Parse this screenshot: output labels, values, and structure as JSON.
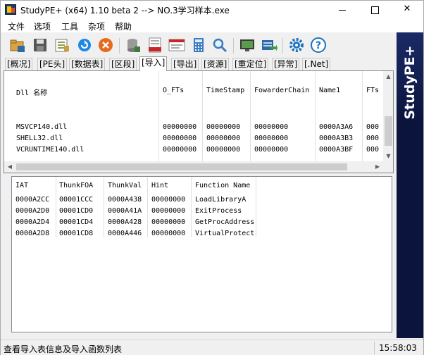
{
  "window": {
    "title": "StudyPE+ (x64) 1.10 beta 2  --> NO.3学习样本.exe"
  },
  "menu": [
    "文件",
    "选项",
    "工具",
    "杂项",
    "帮助"
  ],
  "toolbar": {
    "buttons": [
      {
        "name": "open-file-icon",
        "color": "#c89b3c"
      },
      {
        "name": "save-icon",
        "color": "#4a4a4a"
      },
      {
        "name": "hex-view-icon",
        "color": "#7f8c4a"
      },
      {
        "name": "refresh-icon",
        "color": "#1e88e5"
      },
      {
        "name": "close-file-icon",
        "color": "#e86a1e"
      },
      {
        "name": "database-icon",
        "color": "#7a7a7a"
      },
      {
        "name": "asm-icon",
        "color": "#c62828"
      },
      {
        "name": "asm-window-icon",
        "color": "#c62828"
      },
      {
        "name": "calculator-icon",
        "color": "#3b7bbf"
      },
      {
        "name": "search-icon",
        "color": "#3b7bbf"
      },
      {
        "name": "monitor-icon",
        "color": "#3e7a3e"
      },
      {
        "name": "export-icon",
        "color": "#2e6aa6"
      },
      {
        "name": "settings-icon",
        "color": "#1e73be"
      },
      {
        "name": "help-icon",
        "color": "#1e73be"
      }
    ]
  },
  "sidebar": {
    "brand": "StudyPE+"
  },
  "tabs": [
    {
      "label": "[概况]"
    },
    {
      "label": "[PE头]"
    },
    {
      "label": "[数据表]"
    },
    {
      "label": "[区段]"
    },
    {
      "label": "[导入]",
      "active": true
    },
    {
      "label": "[导出]"
    },
    {
      "label": "[资源]"
    },
    {
      "label": "[重定位]"
    },
    {
      "label": "[异常]"
    },
    {
      "label": "[.Net]"
    }
  ],
  "dll_table": {
    "headers": [
      "Dll 名称",
      "O_FTs",
      "TimeStamp",
      "FowarderChain",
      "Name1",
      "FTs"
    ],
    "rows": [
      [
        "MSVCP140.dll",
        "00000000",
        "00000000",
        "00000000",
        "0000A3A6",
        "000"
      ],
      [
        "SHELL32.dll",
        "00000000",
        "00000000",
        "00000000",
        "0000A3B3",
        "000"
      ],
      [
        "VCRUNTIME140.dll",
        "00000000",
        "00000000",
        "00000000",
        "0000A3BF",
        "000"
      ]
    ]
  },
  "func_table": {
    "headers": [
      "IAT",
      "ThunkFOA",
      "ThunkVal",
      "Hint",
      "Function Name"
    ],
    "rows": [
      [
        "0000A2CC",
        "00001CCC",
        "0000A438",
        "00000000",
        "LoadLibraryA"
      ],
      [
        "0000A2D0",
        "00001CD0",
        "0000A41A",
        "00000000",
        "ExitProcess"
      ],
      [
        "0000A2D4",
        "00001CD4",
        "0000A428",
        "00000000",
        "GetProcAddress"
      ],
      [
        "0000A2D8",
        "00001CD8",
        "0000A446",
        "00000000",
        "VirtualProtect"
      ]
    ]
  },
  "status": {
    "message": "查看导入表信息及导入函数列表",
    "time": "15:58:03"
  }
}
